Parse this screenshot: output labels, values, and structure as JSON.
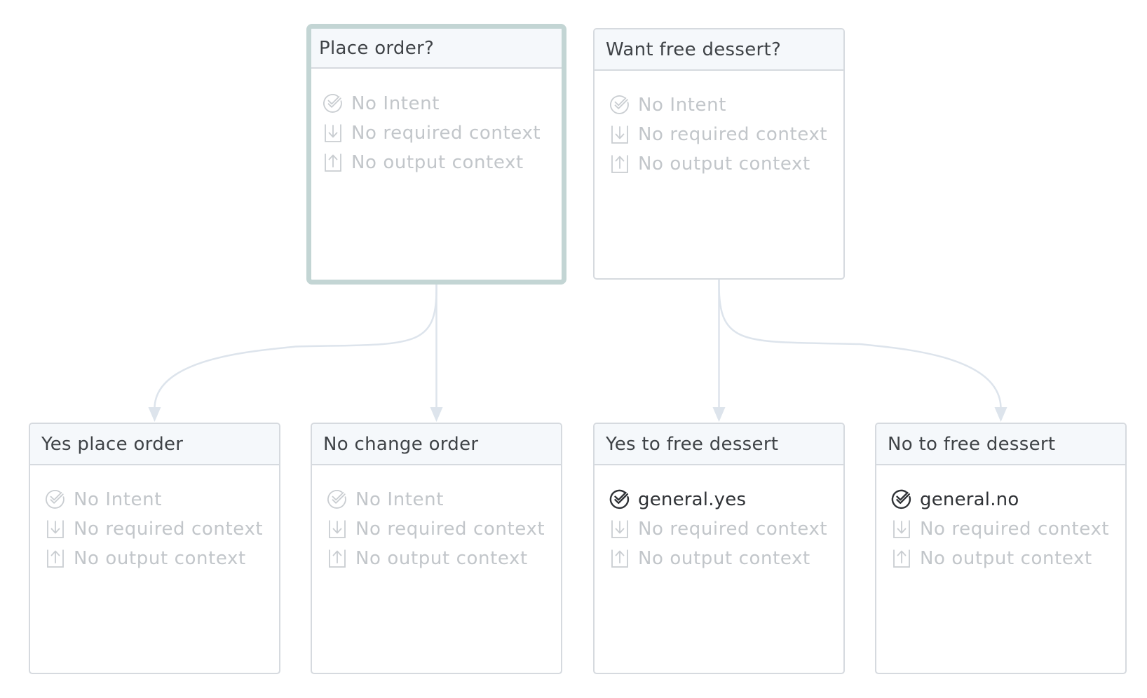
{
  "nodes": [
    {
      "id": "place-order",
      "title": "Place order?",
      "selected": true,
      "intent": "No Intent",
      "intent_set": false,
      "required_context": "No required context",
      "output_context": "No output context"
    },
    {
      "id": "want-free-dessert",
      "title": "Want free dessert?",
      "selected": false,
      "intent": "No Intent",
      "intent_set": false,
      "required_context": "No required context",
      "output_context": "No output context"
    },
    {
      "id": "yes-place-order",
      "title": "Yes place order",
      "selected": false,
      "intent": "No Intent",
      "intent_set": false,
      "required_context": "No required context",
      "output_context": "No output context"
    },
    {
      "id": "no-change-order",
      "title": "No change order",
      "selected": false,
      "intent": "No Intent",
      "intent_set": false,
      "required_context": "No required context",
      "output_context": "No output context"
    },
    {
      "id": "yes-to-free-dessert",
      "title": "Yes to free dessert",
      "selected": false,
      "intent": "general.yes",
      "intent_set": true,
      "required_context": "No required context",
      "output_context": "No output context"
    },
    {
      "id": "no-to-free-dessert",
      "title": "No to free dessert",
      "selected": false,
      "intent": "general.no",
      "intent_set": true,
      "required_context": "No required context",
      "output_context": "No output context"
    }
  ],
  "edges": [
    {
      "from": "place-order",
      "to": "yes-place-order"
    },
    {
      "from": "place-order",
      "to": "no-change-order"
    },
    {
      "from": "want-free-dessert",
      "to": "yes-to-free-dessert"
    },
    {
      "from": "want-free-dessert",
      "to": "no-to-free-dessert"
    }
  ],
  "icons": {
    "intent": "check-circle-icon",
    "required_context": "download-tray-icon",
    "output_context": "upload-tray-icon"
  },
  "colors": {
    "edge": "#dde4ec",
    "border": "#d6dadf",
    "selected_border": "#c3d5d4",
    "header_bg": "#f5f8fb",
    "muted_text": "#c2c6ca",
    "active_text": "#2f3236"
  }
}
